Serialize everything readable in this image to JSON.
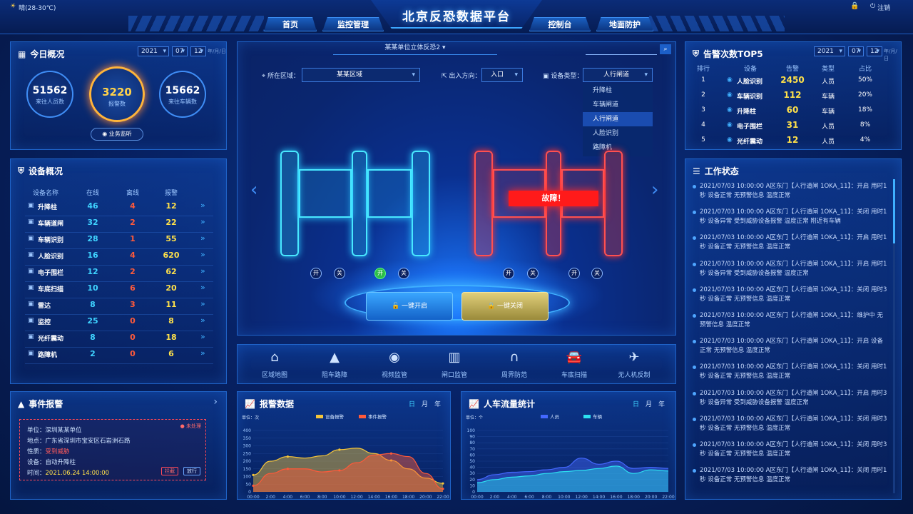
{
  "header": {
    "weather": "晴(28-30℃)",
    "title": "北京反恐数据平台",
    "nav_left": [
      "首页",
      "监控管理"
    ],
    "nav_right": [
      "控制台",
      "地面防护"
    ],
    "logout": "注销"
  },
  "today": {
    "title": "今日概况",
    "date": [
      "2021",
      "07",
      "12"
    ],
    "unit": "年/月/日",
    "stats": [
      {
        "value": "51562",
        "label": "来往人员数"
      },
      {
        "value": "3220",
        "label": "报警数"
      },
      {
        "value": "15662",
        "label": "来往车辆数"
      }
    ],
    "btn": "业务监听"
  },
  "devices": {
    "title": "设备概况",
    "headers": [
      "设备名称",
      "在线",
      "离线",
      "报警"
    ],
    "rows": [
      [
        "升降柱",
        "46",
        "4",
        "12"
      ],
      [
        "车辆道闸",
        "32",
        "2",
        "22"
      ],
      [
        "车辆识别",
        "28",
        "1",
        "55"
      ],
      [
        "人脸识别",
        "16",
        "4",
        "620"
      ],
      [
        "电子围栏",
        "12",
        "2",
        "62"
      ],
      [
        "车底扫描",
        "10",
        "6",
        "20"
      ],
      [
        "雷达",
        "8",
        "3",
        "11"
      ],
      [
        "监控",
        "25",
        "0",
        "8"
      ],
      [
        "光纤震动",
        "8",
        "0",
        "18"
      ],
      [
        "路障机",
        "2",
        "0",
        "6"
      ]
    ]
  },
  "event": {
    "title": "事件报警",
    "status": "未处理",
    "lines": [
      {
        "k": "单位：",
        "v": "深圳某某单位"
      },
      {
        "k": "地点：",
        "v": "广东省深圳市宝安区石岩洲石路"
      },
      {
        "k": "性质：",
        "v": "受到威胁"
      },
      {
        "k": "设备：",
        "v": "自动升降柱"
      },
      {
        "k": "时间：",
        "v": "2021.06.24 14:00:00"
      }
    ],
    "btn1": "拦截",
    "btn2": "放行"
  },
  "center": {
    "unit_select": "某某单位立体反恐2",
    "area_label": "所在区域：",
    "area": "某某区域",
    "dir_label": "出入方向：",
    "dir": "入口",
    "type_label": "设备类型：",
    "type": "人行闸道",
    "type_options": [
      "升降柱",
      "车辆闸道",
      "人行闸道",
      "人脸识别",
      "路障机"
    ],
    "fault": "故障！",
    "open_all": "一键开启",
    "close_all": "一键关闭",
    "open": "开",
    "close": "关"
  },
  "icons": [
    {
      "label": "区域地图",
      "icon": "map-pin-icon"
    },
    {
      "label": "阻车路障",
      "icon": "roadblock-icon"
    },
    {
      "label": "视频监管",
      "icon": "camera-icon"
    },
    {
      "label": "闸口监管",
      "icon": "gate-icon"
    },
    {
      "label": "周界防范",
      "icon": "arch-icon"
    },
    {
      "label": "车底扫描",
      "icon": "car-icon"
    },
    {
      "label": "无人机反制",
      "icon": "drone-icon"
    }
  ],
  "top5": {
    "title": "告警次数TOP5",
    "date": [
      "2021",
      "07",
      "12"
    ],
    "unit": "年/月/日",
    "headers": [
      "排行",
      "设备",
      "告警",
      "类型",
      "占比"
    ],
    "rows": [
      [
        "1",
        "人脸识别",
        "2450",
        "人员",
        "50%"
      ],
      [
        "2",
        "车辆识别",
        "112",
        "车辆",
        "20%"
      ],
      [
        "3",
        "升降柱",
        "60",
        "车辆",
        "18%"
      ],
      [
        "4",
        "电子围栏",
        "31",
        "人员",
        "8%"
      ],
      [
        "5",
        "光纤震动",
        "12",
        "人员",
        "4%"
      ]
    ]
  },
  "work": {
    "title": "工作状态",
    "items": [
      "2021/07/03 10:00:00 A区东门【人行道闸 1OKA_11】：开启 用时1秒 设备正常 无预警信息 温度正常",
      "2021/07/03 10:00:00 A区东门【人行道闸 1OKA_11】：关闭 用时1秒 设备异常 受到威胁设备报警 温度正常 附近有车辆",
      "2021/07/03 10:00:00 A区东门【人行道闸 1OKA_11】：开启 用时1秒 设备正常 无预警信息 温度正常",
      "2021/07/03 10:00:00 A区东门【人行道闸 1OKA_11】：开启 用时1秒 设备异常 受到威胁设备报警 温度正常",
      "2021/07/03 10:00:00 A区东门【人行道闸 1OKA_11】：关闭 用时3秒 设备正常 无预警信息 温度正常",
      "2021/07/03 10:00:00 A区东门【人行道闸 1OKA_11】：维护中 无预警信息 温度正常",
      "2021/07/03 10:00:00 A区东门【人行道闸 1OKA_11】：开启 设备正常 无预警信息 温度正常",
      "2021/07/03 10:00:00 A区东门【人行道闸 1OKA_11】：关闭 用时1秒 设备正常 无预警信息 温度正常",
      "2021/07/03 10:00:00 A区东门【人行道闸 1OKA_11】：开启 用时3秒 设备异常 受到威胁设备报警 温度正常",
      "2021/07/03 10:00:00 A区东门【人行道闸 1OKA_11】：关闭 用时3秒 设备正常 无预警信息 温度正常",
      "2021/07/03 10:00:00 A区东门【人行道闸 1OKA_11】：关闭 用时3秒 设备正常 无预警信息 温度正常",
      "2021/07/03 10:00:00 A区东门【人行道闸 1OKA_11】：关闭 用时1秒 设备正常 无预警信息 温度正常"
    ]
  },
  "tabs": [
    "日",
    "月",
    "年"
  ],
  "chart_data": [
    {
      "type": "area",
      "title": "报警数据",
      "ylabel": "单位：次",
      "ylim": [
        0,
        400
      ],
      "yticks": [
        0,
        50,
        100,
        150,
        200,
        250,
        300,
        350,
        400
      ],
      "x": [
        "00:00",
        "2:00",
        "4:00",
        "6:00",
        "8:00",
        "10:00",
        "12:00",
        "14:00",
        "16:00",
        "18:00",
        "20:00",
        "22:00"
      ],
      "series": [
        {
          "name": "设备报警",
          "color": "#f5c53a",
          "values": [
            110,
            200,
            230,
            220,
            235,
            275,
            285,
            250,
            205,
            150,
            90,
            55
          ]
        },
        {
          "name": "事件报警",
          "color": "#ff5a3a",
          "values": [
            40,
            120,
            150,
            150,
            130,
            140,
            190,
            240,
            250,
            230,
            120,
            20
          ]
        }
      ]
    },
    {
      "type": "area",
      "title": "人车流量统计",
      "ylabel": "单位：个",
      "ylim": [
        0,
        100
      ],
      "yticks": [
        0,
        10,
        20,
        30,
        40,
        50,
        60,
        70,
        80,
        90,
        100
      ],
      "x": [
        "00:00",
        "2:00",
        "4:00",
        "6:00",
        "8:00",
        "10:00",
        "12:00",
        "14:00",
        "16:00",
        "18:00",
        "20:00",
        "22:00"
      ],
      "series": [
        {
          "name": "人员",
          "color": "#4468ff",
          "values": [
            20,
            28,
            32,
            33,
            36,
            40,
            55,
            45,
            50,
            38,
            40,
            38
          ]
        },
        {
          "name": "车辆",
          "color": "#2ce0f0",
          "values": [
            15,
            20,
            24,
            26,
            30,
            33,
            35,
            38,
            42,
            30,
            36,
            34
          ]
        }
      ]
    }
  ]
}
